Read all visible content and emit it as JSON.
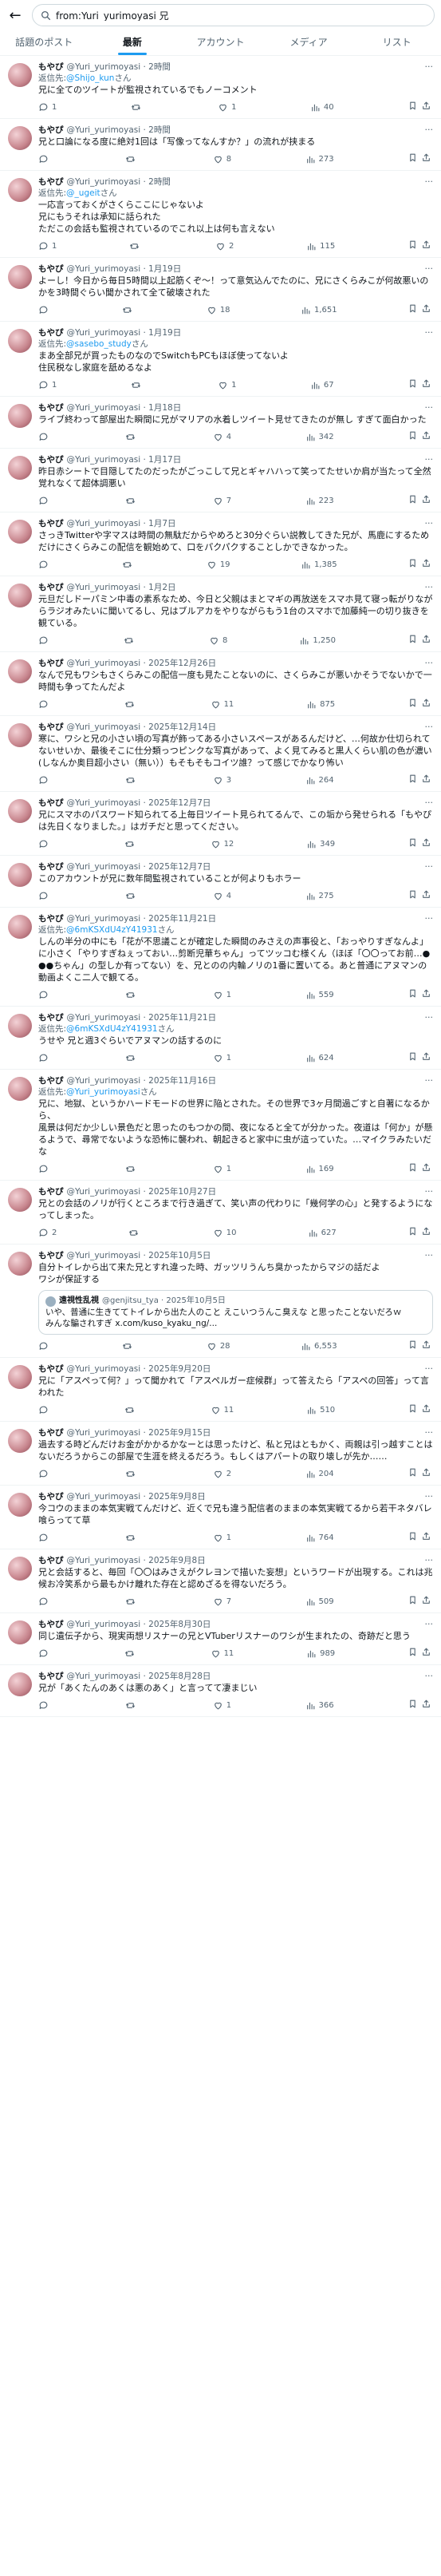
{
  "search": {
    "query": "from:Yuri_yurimoyasi 兄"
  },
  "tabs": [
    {
      "label": "話題のポスト"
    },
    {
      "label": "最新"
    },
    {
      "label": "アカウント"
    },
    {
      "label": "メディア"
    },
    {
      "label": "リスト"
    }
  ],
  "reply_prefix": "返信先:",
  "reply_suffix": "さん",
  "posts": [
    {
      "name": "もやぴ",
      "handle": "@Yuri_yurimoyasi · 2時間",
      "reply_to": "@Shijo_kun",
      "text": "兄に全てのツイートが監視されているでもノーコメント",
      "replies": "1",
      "reposts": "",
      "likes": "1",
      "views": "40",
      "quote": null
    },
    {
      "name": "もやぴ",
      "handle": "@Yuri_yurimoyasi · 2時間",
      "reply_to": "",
      "text": "兄と口論になる度に絶対1回は「写像ってなんすか？」の流れが挟まる",
      "replies": "",
      "reposts": "",
      "likes": "8",
      "views": "273",
      "quote": null
    },
    {
      "name": "もやぴ",
      "handle": "@Yuri_yurimoyasi · 2時間",
      "reply_to": "@_ugeit",
      "text": "一応言っておくがさくらここにじゃないよ\n兄にもうそれは承知に話られた\nただこの会話も監視されているのでこれ以上は何も言えない",
      "replies": "1",
      "reposts": "",
      "likes": "2",
      "views": "115",
      "quote": null
    },
    {
      "name": "もやぴ",
      "handle": "@Yuri_yurimoyasi · 1月19日",
      "reply_to": "",
      "text": "よーし！今日から毎日5時間以上起筋くぞ〜！って意気込んでたのに、兄にさくらみこが何故悪いのかを3時間ぐらい聞かされて全て破壊された",
      "replies": "",
      "reposts": "",
      "likes": "18",
      "views": "1,651",
      "quote": null
    },
    {
      "name": "もやぴ",
      "handle": "@Yuri_yurimoyasi · 1月19日",
      "reply_to": "@sasebo_study",
      "text": "まあ全部兄が買ったものなのでSwitchもPCもほぼ使ってないよ\n住民税なし家庭を舐めるなよ",
      "replies": "1",
      "reposts": "",
      "likes": "1",
      "views": "67",
      "quote": null
    },
    {
      "name": "もやぴ",
      "handle": "@Yuri_yurimoyasi · 1月18日",
      "reply_to": "",
      "text": "ライブ終わって部屋出た瞬間に兄がマリアの水着しツイート見せてきたのが無し すぎて面白かった",
      "replies": "",
      "reposts": "",
      "likes": "4",
      "views": "342",
      "quote": null
    },
    {
      "name": "もやぴ",
      "handle": "@Yuri_yurimoyasi · 1月17日",
      "reply_to": "",
      "text": "昨日赤シートで目隠してたのだったがごっこして兄とギャハハって笑ってたせいか肩が当たって全然覚れなくて超体調悪い",
      "replies": "",
      "reposts": "",
      "likes": "7",
      "views": "223",
      "quote": null
    },
    {
      "name": "もやぴ",
      "handle": "@Yuri_yurimoyasi · 1月7日",
      "reply_to": "",
      "text": "さっきTwitterや字マスは時間の無駄だからやめろと30分ぐらい説教してきた兄が、馬鹿にするためだけにさくらみこの配信を観始めて、口をパクパクすることしかできなかった。",
      "replies": "",
      "reposts": "",
      "likes": "19",
      "views": "1,385",
      "quote": null
    },
    {
      "name": "もやぴ",
      "handle": "@Yuri_yurimoyasi · 1月2日",
      "reply_to": "",
      "text": "元旦だしドーパミン中毒の素系なため、今日と父親はまとマギの再放送をスマホ見て寝っ転がりながらラジオみたいに聞いてるし、兄はブルアカをやりながらもう1台のスマホで加藤純一の切り抜きを観ている。",
      "replies": "",
      "reposts": "",
      "likes": "8",
      "views": "1,250",
      "quote": null
    },
    {
      "name": "もやぴ",
      "handle": "@Yuri_yurimoyasi · 2025年12月26日",
      "reply_to": "",
      "text": "なんで兄もワシもさくらみこの配信一度も見たことないのに、さくらみこが悪いかそうでないかで一時間も争ってたんだよ",
      "replies": "",
      "reposts": "",
      "likes": "11",
      "views": "875",
      "quote": null
    },
    {
      "name": "もやぴ",
      "handle": "@Yuri_yurimoyasi · 2025年12月14日",
      "reply_to": "",
      "text": "寒に、ワシと兄の小さい頃の写真が飾ってある小さいスペースがあるんだけど、…何故か仕切られてないせいか、最後そこに仕分類っつピンクな写真があって、よく見てみると黒人くらい肌の色が濃い(しなんか奥目超小さい（無い））もそもそもコイツ誰？って感じでかなり怖い",
      "replies": "",
      "reposts": "",
      "likes": "3",
      "views": "264",
      "quote": null
    },
    {
      "name": "もやぴ",
      "handle": "@Yuri_yurimoyasi · 2025年12月7日",
      "reply_to": "",
      "text": "兄にスマホのパスワード知られてる上毎日ツイート見られてるんで、この垢から発せられる「もやぴは先日くなりました。」はガチだと思ってください。",
      "replies": "",
      "reposts": "",
      "likes": "12",
      "views": "349",
      "quote": null
    },
    {
      "name": "もやぴ",
      "handle": "@Yuri_yurimoyasi · 2025年12月7日",
      "reply_to": "",
      "text": "このアカウントが兄に数年間監視されていることが何よりもホラー",
      "replies": "",
      "reposts": "",
      "likes": "4",
      "views": "275",
      "quote": null
    },
    {
      "name": "もやぴ",
      "handle": "@Yuri_yurimoyasi · 2025年11月21日",
      "reply_to": "@6mKSXdU4zY41931",
      "text": "しんの半分の中にも「花が不思議ことが確定した瞬間のみさえの声事役と、「おっやりすぎなんよ」に小さく「やりすぎねぇっておい…剪断児華ちゃん」ってツッコむ様くん（ほぼ「〇〇ってお前…●●●ちゃん」の型しか有ってない）を、兄とのの内輪ノリの1番に置いてる。あと普通にアヌマンの動画よくこ二人で観てる。",
      "replies": "",
      "reposts": "",
      "likes": "1",
      "views": "559",
      "quote": null
    },
    {
      "name": "もやぴ",
      "handle": "@Yuri_yurimoyasi · 2025年11月21日",
      "reply_to": "@6mKSXdU4zY41931",
      "text": "うせや 兄と週3ぐらいでアヌマンの話するのに",
      "replies": "",
      "reposts": "",
      "likes": "1",
      "views": "624",
      "quote": null
    },
    {
      "name": "もやぴ",
      "handle": "@Yuri_yurimoyasi · 2025年11月16日",
      "reply_to": "@Yuri_yurimoyasi",
      "text": "兄に、地獄、というかハードモードの世界に陥とされた。その世界で3ヶ月間過ごすと自著になるから、\n風景は何だか少しい景色だと思ったのもつかの間、夜になると全てが分かった。夜道は「何か」が懸るようで、尋常でないような恐怖に襲われ、朝起きると家中に虫が這っていた。…マイクラみたいだな",
      "replies": "",
      "reposts": "",
      "likes": "1",
      "views": "169",
      "quote": null
    },
    {
      "name": "もやぴ",
      "handle": "@Yuri_yurimoyasi · 2025年10月27日",
      "reply_to": "",
      "text": "兄との会話のノリが行くところまで行き過ぎて、笑い声の代わりに「幾何学の心」と発するようになってしまった。",
      "replies": "2",
      "reposts": "",
      "likes": "10",
      "views": "627",
      "quote": null
    },
    {
      "name": "もやぴ",
      "handle": "@Yuri_yurimoyasi · 2025年10月5日",
      "reply_to": "",
      "text": "自分トイレから出て来た兄とすれ違った時、ガッツリうんち臭かったからマジの話だよ\nワシが保証する",
      "replies": "",
      "reposts": "",
      "likes": "28",
      "views": "6,553",
      "quote": {
        "name": "遠視性乱視",
        "handle": "@genjitsu_tya · 2025年10月5日",
        "text": "いや、普通に生きててトイレから出た人のこと えこいつうんこ臭えな と思ったことないだろｗ\nみんな騙されすぎ x.com/kuso_kyaku_ng/..."
      }
    },
    {
      "name": "もやぴ",
      "handle": "@Yuri_yurimoyasi · 2025年9月20日",
      "reply_to": "",
      "text": "兄に「アスペって何？」って聞かれて「アスペルガー症候群」って答えたら「アスペの回答」って言われた",
      "replies": "",
      "reposts": "",
      "likes": "11",
      "views": "510",
      "quote": null
    },
    {
      "name": "もやぴ",
      "handle": "@Yuri_yurimoyasi · 2025年9月15日",
      "reply_to": "",
      "text": "過去する時どんだけお金がかかるかなーとは思ったけど、私と兄はともかく、両親は引っ越すことはないだろうからこの部屋で生涯を終えるだろう。もしくはアパートの取り壊しが先か……",
      "replies": "",
      "reposts": "",
      "likes": "2",
      "views": "204",
      "quote": null
    },
    {
      "name": "もやぴ",
      "handle": "@Yuri_yurimoyasi · 2025年9月8日",
      "reply_to": "",
      "text": "今コウのままの本気実戦てんだけど、近くで兄も違う配信者のままの本気実戦てるから若干ネタバレ喰らってて草",
      "replies": "",
      "reposts": "",
      "likes": "1",
      "views": "764",
      "quote": null
    },
    {
      "name": "もやぴ",
      "handle": "@Yuri_yurimoyasi · 2025年9月8日",
      "reply_to": "",
      "text": "兄と会話すると、毎回「〇〇はみさえがクレヨンで描いた妄想」というワードが出現する。これは兆候お冷笑系から最もかけ離れた存在と認めざるを得ないだろう。",
      "replies": "",
      "reposts": "",
      "likes": "7",
      "views": "509",
      "quote": null
    },
    {
      "name": "もやぴ",
      "handle": "@Yuri_yurimoyasi · 2025年8月30日",
      "reply_to": "",
      "text": "同じ遺伝子から、現実両想リスナーの兄とVTuberリスナーのワシが生まれたの、奇跡だと思う",
      "replies": "",
      "reposts": "",
      "likes": "11",
      "views": "989",
      "quote": null
    },
    {
      "name": "もやぴ",
      "handle": "@Yuri_yurimoyasi · 2025年8月28日",
      "reply_to": "",
      "text": "兄が「あくたんのあくは悪のあく」と言ってて凄まじい",
      "replies": "",
      "reposts": "",
      "likes": "1",
      "views": "366",
      "quote": null
    }
  ]
}
